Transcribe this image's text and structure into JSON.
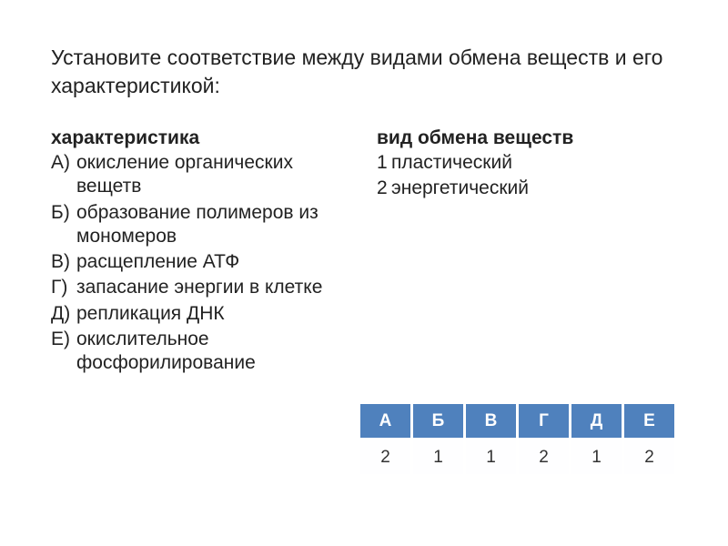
{
  "title": "Установите соответствие между видами обмена веществ и его характеристикой:",
  "left": {
    "heading": "характеристика",
    "items": [
      {
        "mark": "А)",
        "text": "окисление органических вещетв"
      },
      {
        "mark": "Б)",
        "text": "образование полимеров из мономеров"
      },
      {
        "mark": "В)",
        "text": "расщепление АТФ"
      },
      {
        "mark": "Г)",
        "text": "запасание энергии в клетке"
      },
      {
        "mark": "Д)",
        "text": "репликация ДНК"
      },
      {
        "mark": "Е)",
        "text": "окислительное фосфорилирование"
      }
    ]
  },
  "right": {
    "heading": "вид обмена веществ",
    "items": [
      {
        "mark": "1",
        "text": "пластический"
      },
      {
        "mark": "2",
        "text": "энергетический"
      }
    ]
  },
  "chart_data": {
    "type": "table",
    "headers": [
      "А",
      "Б",
      "В",
      "Г",
      "Д",
      "Е"
    ],
    "values": [
      2,
      1,
      1,
      2,
      1,
      2
    ]
  }
}
